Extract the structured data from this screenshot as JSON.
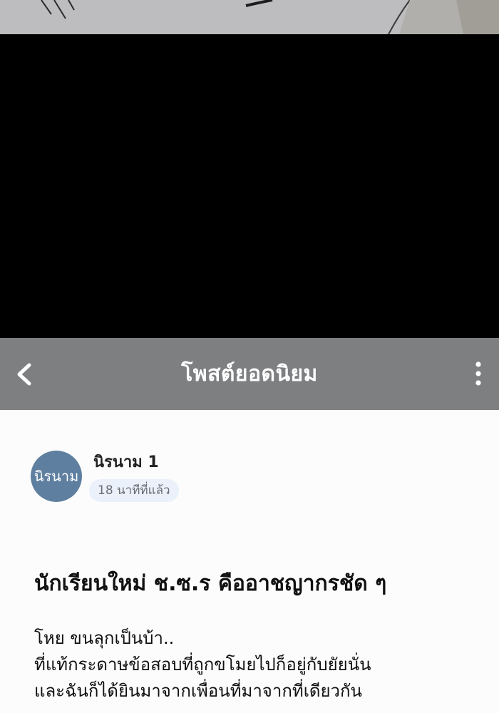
{
  "header": {
    "title": "โพสต์ยอดนิยม",
    "back_icon": "chevron-left-icon",
    "more_icon": "more-vertical-icon"
  },
  "post": {
    "avatar_text": "นิรนาม",
    "author": "นิรนาม 1",
    "time": "18 นาทีที่แล้ว",
    "title": "นักเรียนใหม่ ช.ซ.ร คืออาชญากรชัด ๆ",
    "body_lines": [
      "โหย ขนลุกเป็นบ้า..",
      "ที่แท้กระดาษข้อสอบที่ถูกขโมยไปก็อยู่กับยัยนั่น",
      "และฉันก็ได้ยินมาจากเพื่อนที่มาจากที่เดียวกัน"
    ]
  },
  "colors": {
    "header_bg": "#7e7f81",
    "avatar_bg": "#5e7f9f",
    "badge_bg": "#eaf1fb"
  }
}
